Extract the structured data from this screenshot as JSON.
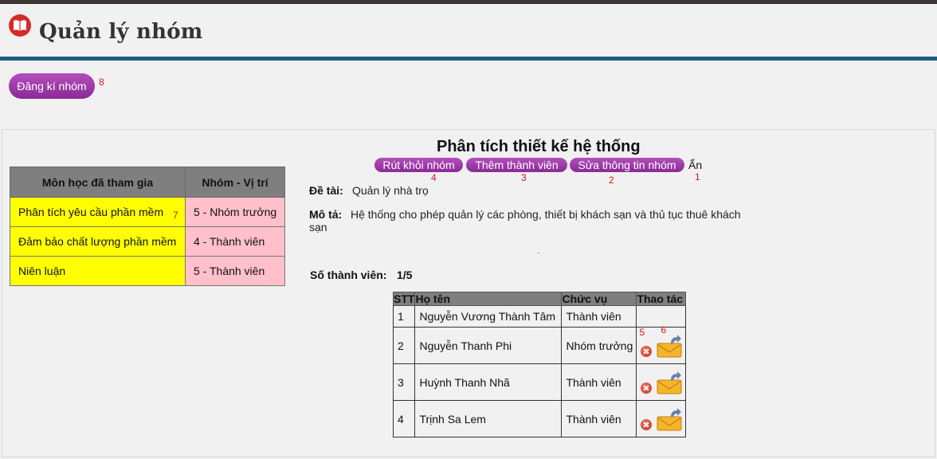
{
  "header": {
    "title": "Quản lý nhóm"
  },
  "register_button": {
    "label": "Đăng kí nhóm",
    "annotation": "8"
  },
  "subjects_table": {
    "headers": [
      "Môn học đã tham gia",
      "Nhóm - Vị trí"
    ],
    "rows": [
      {
        "subject": "Phân tích yêu cầu phần mềm",
        "group": "5 - Nhóm trưởng"
      },
      {
        "subject": "Đảm bảo chất lượng phần mềm",
        "group": "4 - Thành viên"
      },
      {
        "subject": "Niên luận",
        "group": "5 - Thành viên"
      }
    ],
    "annotation": "7"
  },
  "group": {
    "title": "Phân tích thiết kế hệ thống",
    "actions": {
      "leave": "Rút khỏi nhóm",
      "add_member": "Thêm thành viên",
      "edit": "Sửa thông tin nhóm",
      "hide": "Ẩn"
    },
    "annotations": {
      "leave": "4",
      "add_member": "3",
      "edit": "2",
      "hide": "1"
    },
    "topic_label": "Đề tài:",
    "topic_value": "Quản lý nhà trọ",
    "description_label": "Mô tả:",
    "description_line1": "Hệ thống cho phép quản lý các phòng, thiết bị khách sạn và thủ tục thuê khách",
    "description_line2": "sạn",
    "member_count_label": "Số thành viên:",
    "member_count_value": "1/5"
  },
  "members_table": {
    "headers": [
      "STT",
      "Họ tên",
      "Chức vụ",
      "Thao tác"
    ],
    "rows": [
      {
        "stt": "1",
        "name": "Nguyễn Vương Thành Tâm",
        "role": "Thành viên"
      },
      {
        "stt": "2",
        "name": "Nguyễn Thanh Phi",
        "role": "Nhóm trưởng"
      },
      {
        "stt": "3",
        "name": "Huỳnh Thanh Nhã",
        "role": "Thành viên"
      },
      {
        "stt": "4",
        "name": "Trịnh Sa Lem",
        "role": "Thành viên"
      }
    ],
    "annotations": {
      "delete": "5",
      "mail": "6"
    }
  },
  "colors": {
    "accent_purple": "#9b3aa6",
    "header_rule": "#1f5a84",
    "subject_bg": "#ffff00",
    "group_bg": "#ffc0cb",
    "annotation": "#d31818"
  }
}
